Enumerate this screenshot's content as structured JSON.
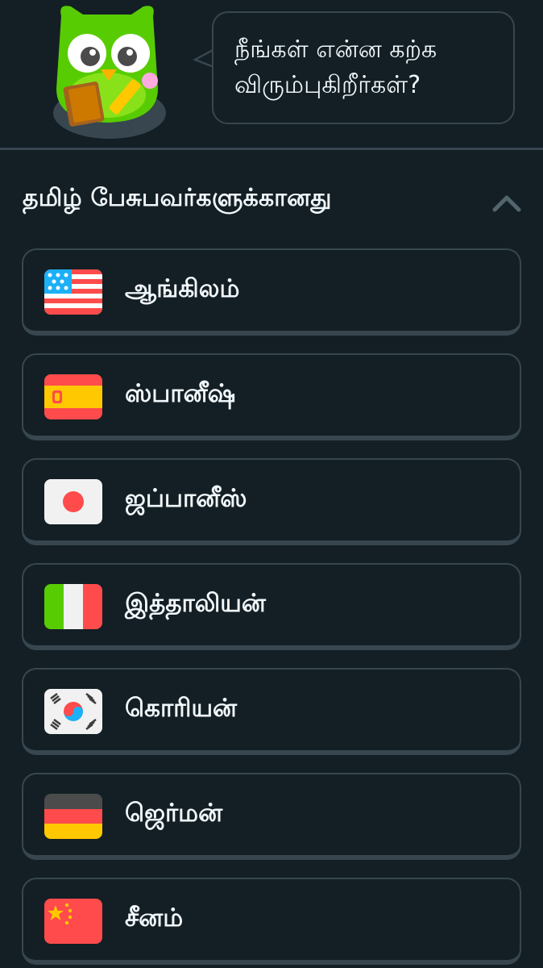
{
  "prompt": {
    "question": "நீங்கள் என்ன கற்க விரும்புகிறீர்கள்?"
  },
  "section": {
    "title": "தமிழ் பேசுபவர்களுக்கானது",
    "collapse_icon": "chevron-up-icon"
  },
  "courses": [
    {
      "label": "ஆங்கிலம்",
      "flag": "us-flag-icon"
    },
    {
      "label": "ஸ்பானீஷ்",
      "flag": "spain-flag-icon"
    },
    {
      "label": "ஜப்பானீஸ்",
      "flag": "japan-flag-icon"
    },
    {
      "label": "இத்தாலியன்",
      "flag": "italy-flag-icon"
    },
    {
      "label": "கொரியன்",
      "flag": "korea-flag-icon"
    },
    {
      "label": "ஜெர்மன்",
      "flag": "germany-flag-icon"
    },
    {
      "label": "சீனம்",
      "flag": "china-flag-icon"
    }
  ],
  "colors": {
    "background": "#131f24",
    "border": "#37464f",
    "text": "#f1f7fb",
    "mascot": "#58cc02"
  }
}
